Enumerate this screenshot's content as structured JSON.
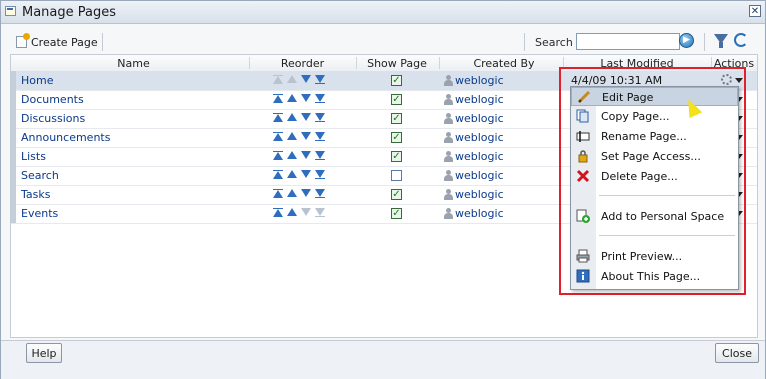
{
  "window": {
    "title": "Manage Pages",
    "close_symbol": "✕"
  },
  "toolbar": {
    "create_label": "Create Page",
    "search_label": "Search",
    "search_value": "",
    "go_symbol": "▶"
  },
  "columns": [
    "Name",
    "Reorder",
    "Show Page",
    "Created By",
    "Last Modified",
    "Actions"
  ],
  "rows": [
    {
      "name": "Home",
      "show": true,
      "creator": "weblogic",
      "last_modified": "4/4/09 10:31 AM",
      "selected": true
    },
    {
      "name": "Documents",
      "show": true,
      "creator": "weblogic",
      "last_modified": ""
    },
    {
      "name": "Discussions",
      "show": true,
      "creator": "weblogic",
      "last_modified": ""
    },
    {
      "name": "Announcements",
      "show": true,
      "creator": "weblogic",
      "last_modified": ""
    },
    {
      "name": "Lists",
      "show": true,
      "creator": "weblogic",
      "last_modified": ""
    },
    {
      "name": "Search",
      "show": false,
      "creator": "weblogic",
      "last_modified": ""
    },
    {
      "name": "Tasks",
      "show": true,
      "creator": "weblogic",
      "last_modified": ""
    },
    {
      "name": "Events",
      "show": true,
      "creator": "weblogic",
      "last_modified": ""
    }
  ],
  "actions_menu": {
    "items": [
      {
        "label": "Edit Page",
        "icon": "pencil-icon"
      },
      {
        "label": "Copy Page...",
        "icon": "copy-icon"
      },
      {
        "label": "Rename Page...",
        "icon": "rename-icon"
      },
      {
        "label": "Set Page Access...",
        "icon": "lock-icon"
      },
      {
        "label": "Delete Page...",
        "icon": "delete-icon"
      },
      {
        "label": "Add to Personal Space",
        "icon": "add-space-icon"
      },
      {
        "label": "Print Preview...",
        "icon": "printer-icon"
      },
      {
        "label": "About This Page...",
        "icon": "info-icon"
      }
    ]
  },
  "footer": {
    "help_label": "Help",
    "close_label": "Close"
  },
  "colors": {
    "link": "#0a3a8a",
    "selected_row": "#d9e2ec",
    "highlight_box": "#e0202a",
    "accent": "#2f6ebf"
  }
}
